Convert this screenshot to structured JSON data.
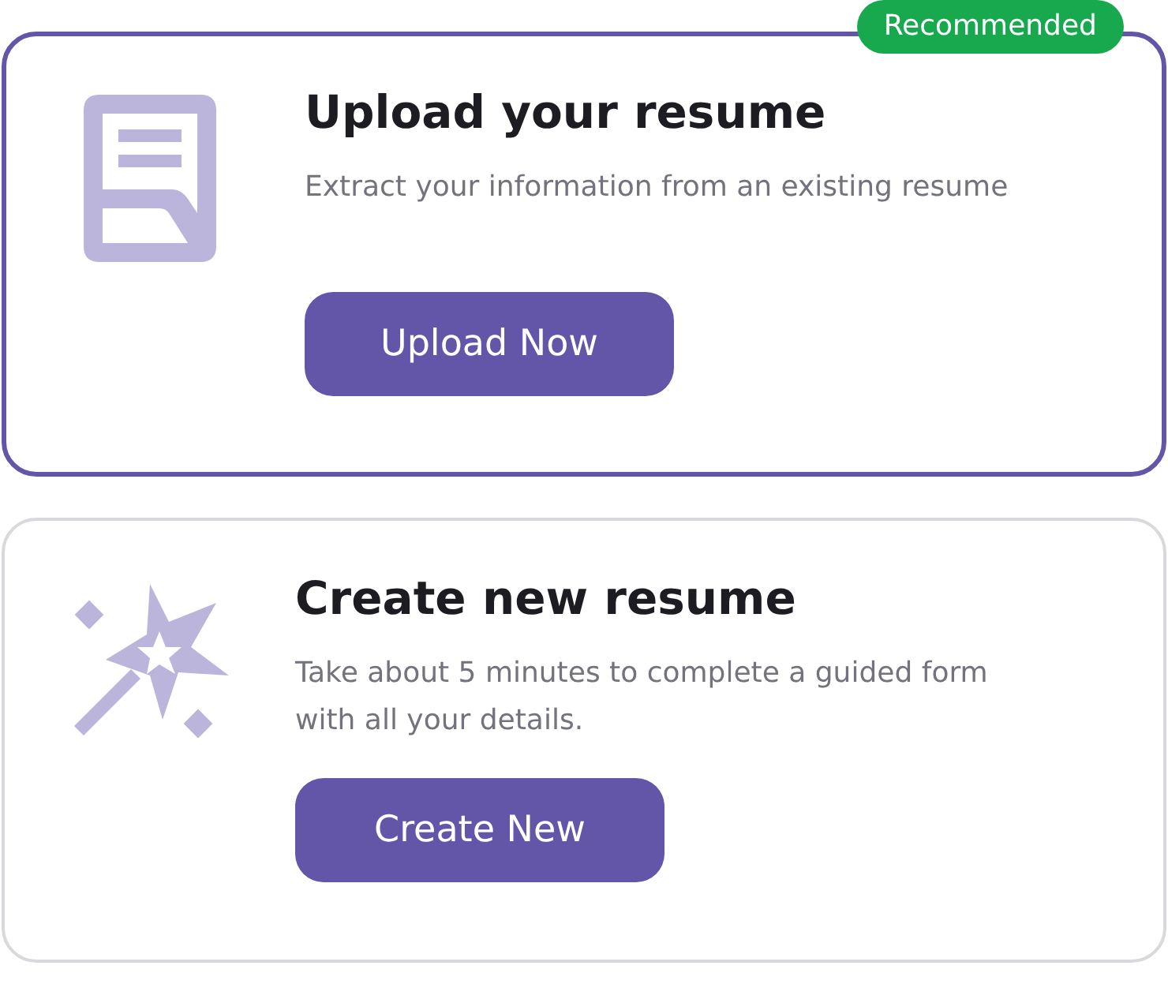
{
  "options": [
    {
      "kind": "upload",
      "selected": true,
      "badge": "Recommended",
      "title": "Upload your resume",
      "description": "Extract your information from an existing resume",
      "button": "Upload Now"
    },
    {
      "kind": "create",
      "selected": false,
      "title": "Create new resume",
      "description": "Take about 5 minutes to complete a guided form with all your details.",
      "button": "Create New"
    }
  ]
}
